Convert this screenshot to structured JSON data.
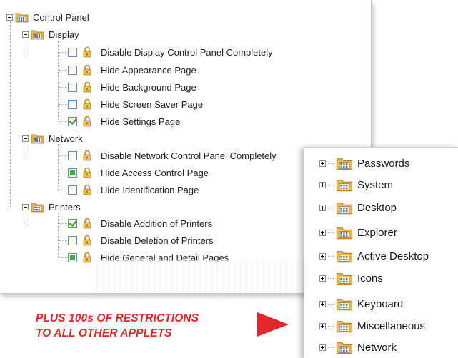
{
  "main_tree": {
    "root": {
      "label": "Control Panel"
    },
    "groups": [
      {
        "label": "Display",
        "items": [
          {
            "label": "Disable Display Control Panel Completely",
            "state": "unchecked"
          },
          {
            "label": "Hide Appearance Page",
            "state": "unchecked"
          },
          {
            "label": "Hide Background Page",
            "state": "unchecked"
          },
          {
            "label": "Hide Screen Saver Page",
            "state": "unchecked"
          },
          {
            "label": "Hide Settings Page",
            "state": "checked"
          }
        ]
      },
      {
        "label": "Network",
        "items": [
          {
            "label": "Disable Network Control Panel Completely",
            "state": "unchecked"
          },
          {
            "label": "Hide Access Control Page",
            "state": "partial"
          },
          {
            "label": "Hide Identification Page",
            "state": "unchecked"
          }
        ]
      },
      {
        "label": "Printers",
        "items": [
          {
            "label": "Disable Addition of Printers",
            "state": "checked"
          },
          {
            "label": "Disable Deletion of Printers",
            "state": "unchecked"
          },
          {
            "label": "Hide General and Detail Pages",
            "state": "partial"
          }
        ]
      }
    ]
  },
  "side_tree": {
    "items": [
      {
        "label": "Passwords"
      },
      {
        "label": "System"
      },
      {
        "label": "Desktop"
      },
      {
        "label": "Explorer"
      },
      {
        "label": "Active Desktop"
      },
      {
        "label": "Icons"
      },
      {
        "label": "Keyboard"
      },
      {
        "label": "Miscellaneous"
      },
      {
        "label": "Network"
      }
    ]
  },
  "promo": {
    "line1": "PLUS 100s OF RESTRICTIONS",
    "line2": "TO ALL OTHER APPLETS"
  },
  "colors": {
    "accent": "#e2282a",
    "check": "#1e9a1e",
    "folder": "#e8b94a"
  },
  "icons": {
    "folder": "folder-control-panel-icon",
    "lock": "lock-icon",
    "expander": "tree-expander-icon"
  }
}
